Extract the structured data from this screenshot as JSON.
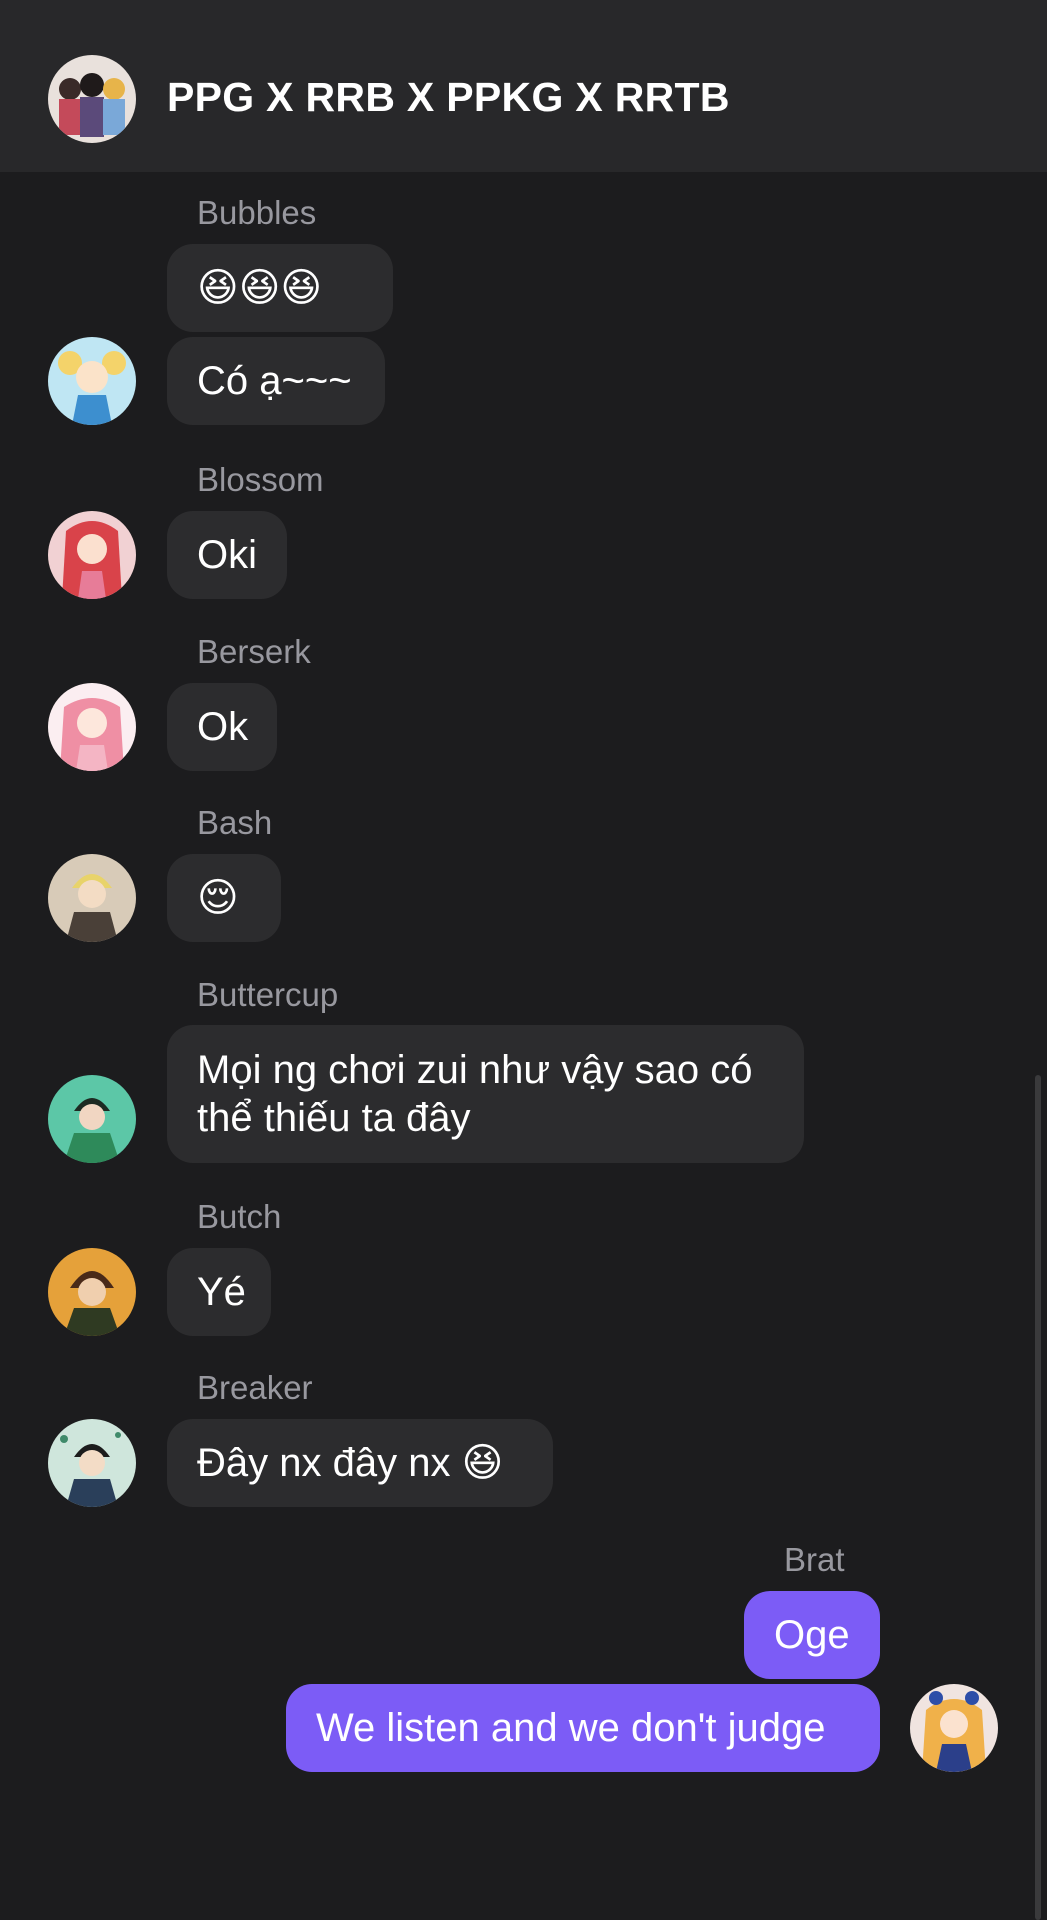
{
  "header": {
    "title": "PPG X RRB X PPKG X RRTB",
    "group_avatar_icon": "group-avatar-icon"
  },
  "colors": {
    "background": "#1c1c1e",
    "header": "#28282a",
    "incoming_bubble": "#2c2c2e",
    "outgoing_bubble": "#7c5cf6",
    "sender_name": "#98989f"
  },
  "messages": [
    {
      "sender": "Bubbles",
      "texts": [
        "😆😆😆",
        "Có ạ~~~"
      ]
    },
    {
      "sender": "Blossom",
      "texts": [
        "Oki"
      ]
    },
    {
      "sender": "Berserk",
      "texts": [
        "Ok"
      ]
    },
    {
      "sender": "Bash",
      "texts": [
        "😌"
      ]
    },
    {
      "sender": "Buttercup",
      "texts": [
        "Mọi ng chơi zui như vậy sao có thể thiếu ta đây"
      ]
    },
    {
      "sender": "Butch",
      "texts": [
        "Yé"
      ]
    },
    {
      "sender": "Breaker",
      "texts": [
        "Đây nx đây nx",
        "😆"
      ]
    },
    {
      "sender": "Brat",
      "outgoing": true,
      "texts": [
        "Oge",
        "We listen and we don't judge"
      ]
    }
  ]
}
